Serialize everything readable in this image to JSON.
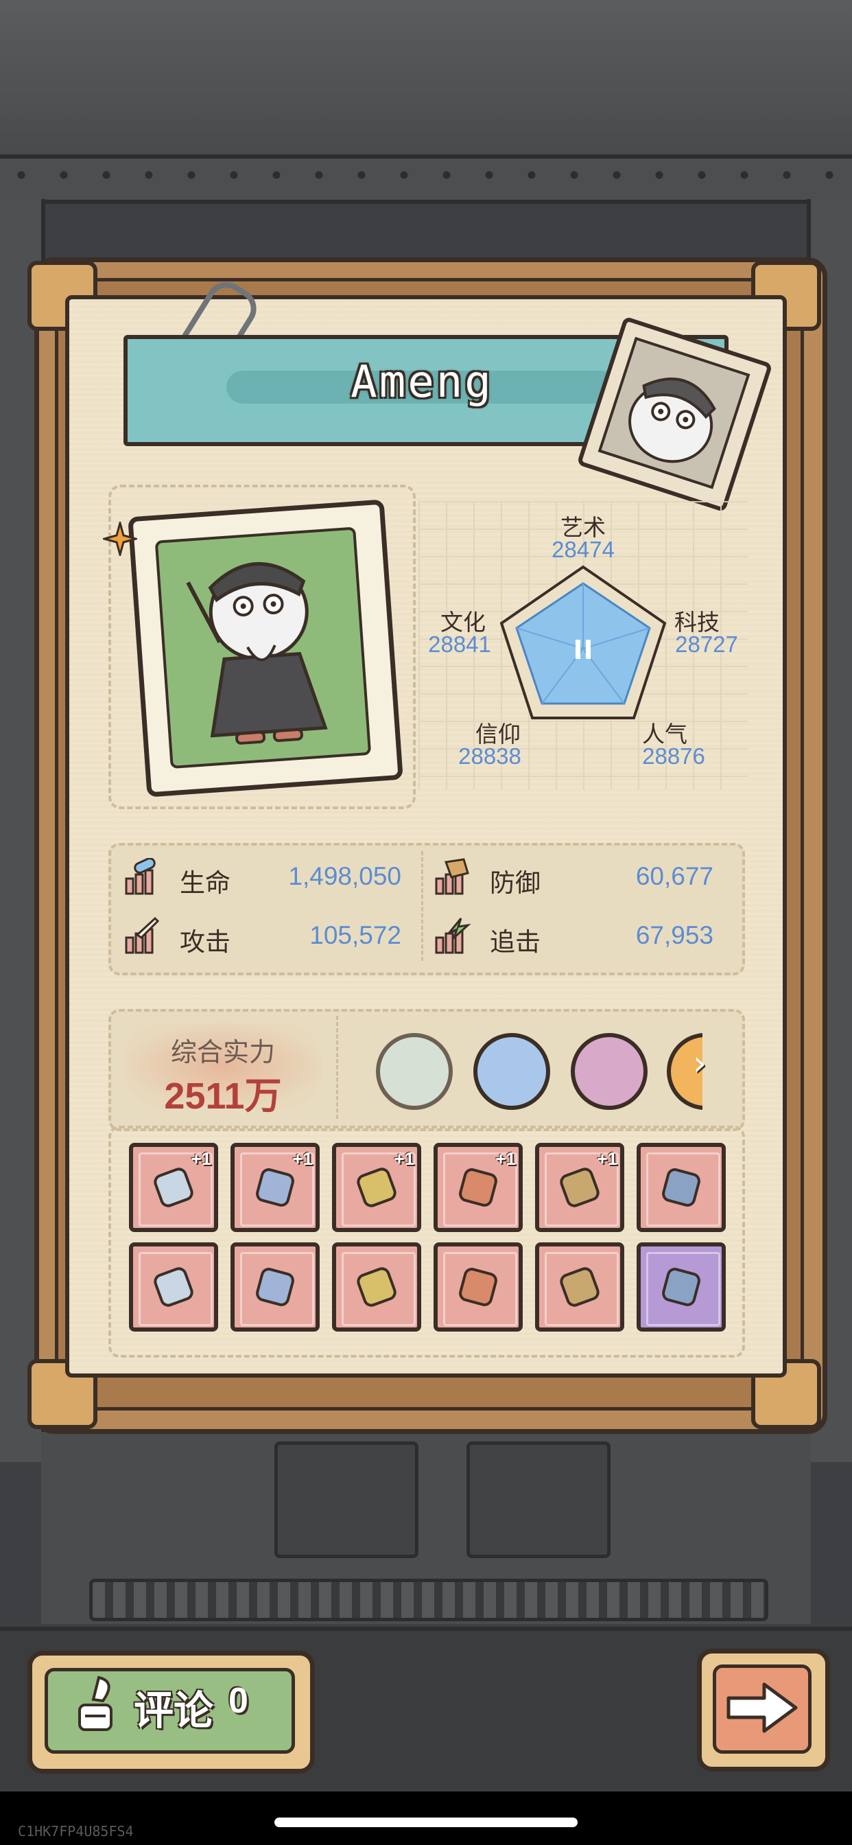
{
  "character": {
    "name": "Ameng"
  },
  "radar": {
    "art": {
      "label": "艺术",
      "value": "28474"
    },
    "culture": {
      "label": "文化",
      "value": "28841"
    },
    "tech": {
      "label": "科技",
      "value": "28727"
    },
    "faith": {
      "label": "信仰",
      "value": "28838"
    },
    "popularity": {
      "label": "人气",
      "value": "28876"
    }
  },
  "stats": {
    "hp": {
      "label": "生命",
      "value": "1,498,050"
    },
    "defense": {
      "label": "防御",
      "value": "60,677"
    },
    "attack": {
      "label": "攻击",
      "value": "105,572"
    },
    "chase": {
      "label": "追击",
      "value": "67,953"
    }
  },
  "power": {
    "label": "综合实力",
    "value": "2511万"
  },
  "badges": [
    "angel-badge",
    "monster-badge",
    "robot-badge",
    "gear-badge"
  ],
  "equipment": {
    "row1": [
      {
        "icon": "brush-sword-icon",
        "plus": "+1"
      },
      {
        "icon": "headband-icon",
        "plus": "+1"
      },
      {
        "icon": "staff-icon",
        "plus": "+1"
      },
      {
        "icon": "rocket-icon",
        "plus": "+1"
      },
      {
        "icon": "crossbow-icon",
        "plus": "+1"
      },
      {
        "icon": "robe-icon",
        "plus": ""
      }
    ],
    "row2": [
      {
        "icon": "backpack-icon",
        "plus": ""
      },
      {
        "icon": "ring-icon",
        "plus": ""
      },
      {
        "icon": "pants-icon",
        "plus": ""
      },
      {
        "icon": "hammer-icon",
        "plus": ""
      },
      {
        "icon": "shirt-icon",
        "plus": ""
      },
      {
        "icon": "tag-amulet-icon",
        "plus": ""
      }
    ]
  },
  "comment": {
    "label": "评论",
    "count": "0"
  },
  "footer": {
    "code": "C1HK7FP4U85FS4"
  },
  "colors": {
    "stat_value": "#5b8cd4",
    "power_value": "#b3413a",
    "slot_red": "#e8a9a1",
    "slot_purple": "#b59ad6"
  }
}
